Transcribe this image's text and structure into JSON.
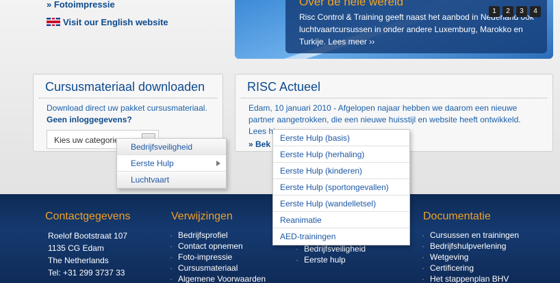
{
  "top_links": {
    "photo": "» Fotoimpressie",
    "english": "Visit our English website"
  },
  "hero": {
    "title": "Over de hele wereld",
    "text": "Risc Control & Training geeft naast het aanbod in Nederland ook luchtvaartcursussen in onder andere Luxemburg, Marokko en Turkije. Lees meer ››",
    "pages": [
      "1",
      "2",
      "3",
      "4"
    ]
  },
  "download_box": {
    "title": "Cursusmateriaal downloaden",
    "text": "Download direct uw pakket cursusmateriaal.",
    "bold": "Geen inloggegevens?",
    "select_value": "Kies uw categorie"
  },
  "news_box": {
    "title": "RISC Actueel",
    "text": "Edam, 10 januari 2010 - Afgelopen najaar hebben we daarom een nieuwe partner aangetrokken, die een nieuwe huisstijl en website heeft ontwikkeld.",
    "text_cut": "Lees hi",
    "more": "» Bek"
  },
  "menu1": {
    "items": [
      "Bedrijfsveiligheid",
      "Eerste Hulp",
      "Luchtvaart"
    ]
  },
  "menu2": {
    "items": [
      "Eerste Hulp (basis)",
      "Eerste Hulp (herhaling)",
      "Eerste Hulp (kinderen)",
      "Eerste Hulp (sportongevallen)",
      "Eerste Hulp (wandelletsel)",
      "Reanimatie",
      "AED-trainingen"
    ]
  },
  "footer": {
    "contact": {
      "title": "Contactgegevens",
      "lines": [
        "Roelof Bootstraat 107",
        "1135 CG Edam",
        "The Netherlands",
        "Tel: +31 299 3737 33"
      ]
    },
    "refs": {
      "title": "Verwijzingen",
      "lines": [
        "Bedrijfsprofiel",
        "Contact opnemen",
        "Foto-impressie",
        "Cursusmateriaal",
        "Algemene Voorwaarden"
      ]
    },
    "mid": {
      "lines": [
        "Bedrijfsveiligheid",
        "Eerste hulp"
      ]
    },
    "docs": {
      "title": "Documentatie",
      "lines": [
        "Cursussen en trainingen",
        "Bedrijfshulpverlening",
        "Wetgeving",
        "Certificering",
        "Het stappenplan BHV"
      ]
    }
  }
}
